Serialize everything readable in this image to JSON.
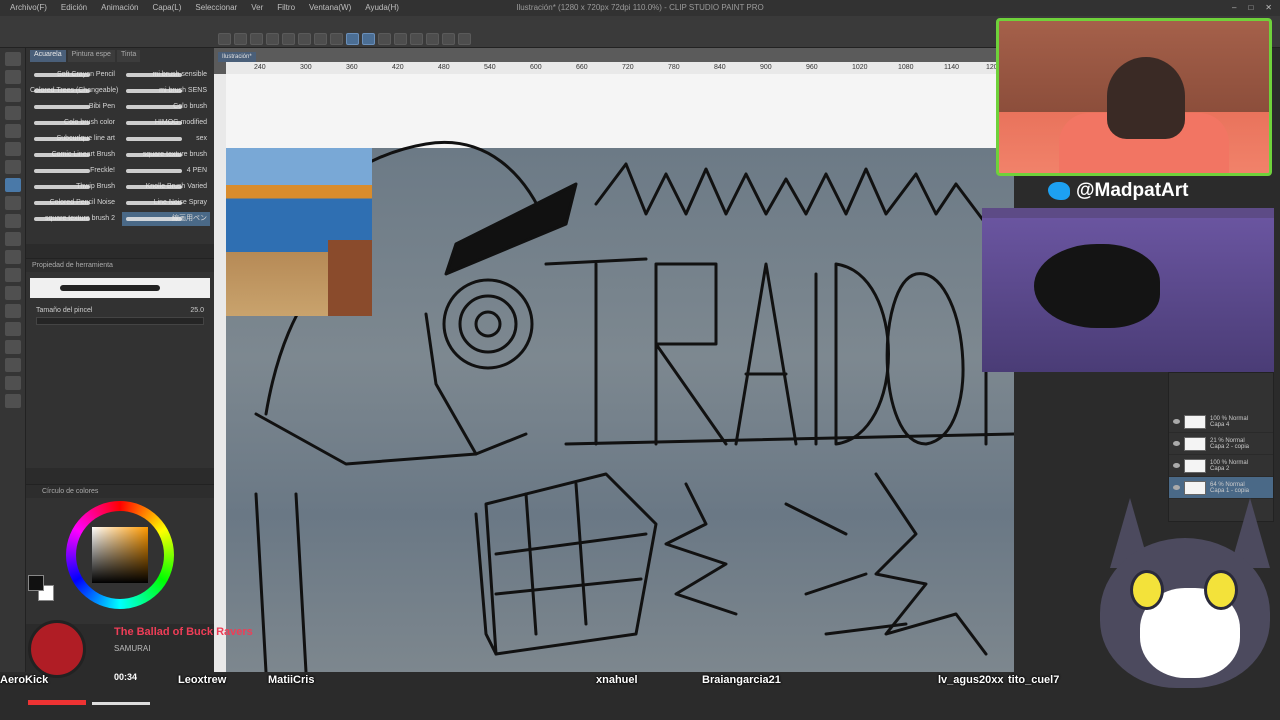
{
  "app": {
    "title": "Ilustración* (1280 x 720px 72dpi 110.0%) - CLIP STUDIO PAINT PRO",
    "menu": [
      "Archivo(F)",
      "Edición",
      "Animación",
      "Capa(L)",
      "Seleccionar",
      "Ver",
      "Filtro",
      "Ventana(W)",
      "Ayuda(H)"
    ]
  },
  "canvas": {
    "doc_tab": "Ilustración*",
    "ruler_ticks": [
      "240",
      "300",
      "360",
      "420",
      "480",
      "540",
      "600",
      "660",
      "720",
      "780",
      "840",
      "900",
      "960",
      "1020",
      "1080",
      "1140",
      "1200"
    ]
  },
  "subtool": {
    "group_label": "Subherramienta",
    "tabs": [
      "Acuarela",
      "Pintura espe",
      "Tinta"
    ],
    "active_tab": "Acuarela",
    "brushes": [
      "Soft Crayon Pencil",
      "mi brush sensible",
      "Colored Trees (Changeable)",
      "mi brush SENS",
      "Bibi Pen",
      "Colo brush",
      "Colo brush color",
      "HIMOG modified",
      "Subcurlque line art",
      "sex",
      "Comic Lineart Brush",
      "square texture brush",
      "Freckle!",
      "4 PEN",
      "Thwip Brush",
      "Knolle Brush Varied",
      "Colored Pencil Noise",
      "Line Noise Spray",
      "square texture brush 2",
      "線画用ペン"
    ],
    "selected_brush": "線画用ペン"
  },
  "tool_property": {
    "header": "Propiedad de herramienta",
    "preset_name": "線画用ペン",
    "brush_size_label": "Tamaño del pincel",
    "brush_size_value": "25.0"
  },
  "color_panel": {
    "header": "Círculo de colores",
    "main_color": "#111111",
    "sub_color": "#ffffff",
    "hue_accent": "#ff9a00"
  },
  "stream": {
    "twitter_handle": "@MadpatArt",
    "music": {
      "title": "The Ballad of Buck Ravers",
      "artist": "SAMURAI",
      "time": "00:34"
    },
    "viewers": [
      "AeroKick",
      "Leoxtrew",
      "MatiiCris",
      "xnahuel",
      "Braiangarcia21",
      "lv_agus20xx",
      "tito_cuel7"
    ]
  },
  "layers": [
    {
      "mode": "100 % Normal",
      "name": "Capa 4"
    },
    {
      "mode": "21 % Normal",
      "name": "Capa 2 - copia"
    },
    {
      "mode": "100 % Normal",
      "name": "Capa 2"
    },
    {
      "mode": "64 % Normal",
      "name": "Capa 1 - copia"
    }
  ],
  "selected_layer_index": 3
}
